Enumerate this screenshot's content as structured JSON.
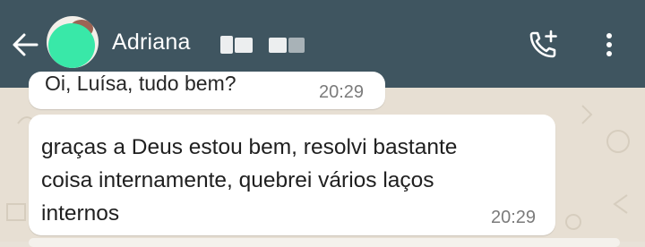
{
  "header": {
    "contact_name": "Adriana",
    "colors": {
      "bar": "#3f5560",
      "text": "#ffffff"
    },
    "icons": [
      "back-arrow-icon",
      "avatar",
      "add-call-icon",
      "more-vert-icon"
    ]
  },
  "messages": [
    {
      "text": "Oi, Luísa, tudo bem?",
      "time": "20:29",
      "visibility": "partially cropped"
    },
    {
      "text": "graças a Deus estou bem, resolvi bastante coisa internamente, quebrei vários laços internos",
      "time": "20:29"
    }
  ],
  "colors": {
    "chat_background": "#e7dfd3",
    "bubble": "#ffffff",
    "timestamp": "#7b7b7b"
  }
}
